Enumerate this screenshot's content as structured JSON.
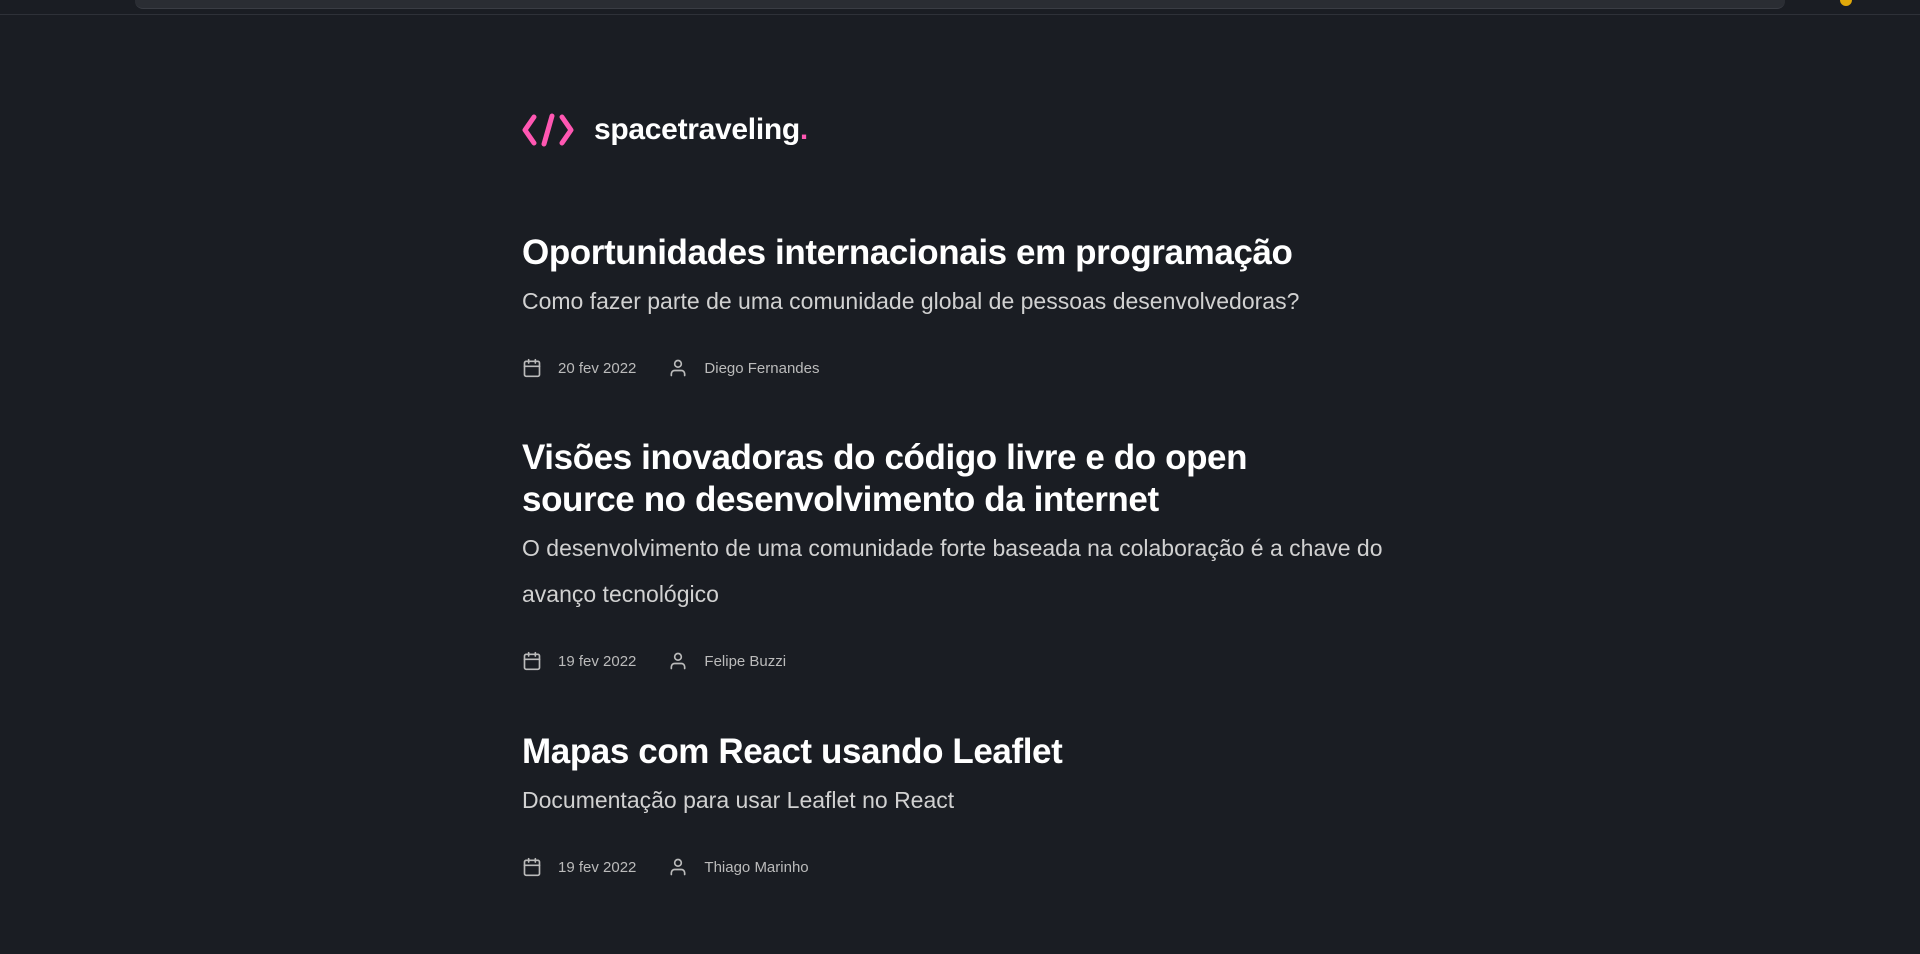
{
  "header": {
    "logo_icon": "code-brackets-icon",
    "logo_text": "spacetraveling",
    "logo_dot": ".",
    "accent_color": "#ff57b2"
  },
  "posts": [
    {
      "title": "Oportunidades internacionais em programação",
      "subtitle": "Como fazer parte de uma comunidade global de pessoas desenvolvedoras?",
      "date": "20 fev 2022",
      "author": "Diego Fernandes"
    },
    {
      "title": "Visões inovadoras do código livre e do open source no desenvolvimento da internet",
      "subtitle": "O desenvolvimento de uma comunidade forte baseada na colaboração é a chave do avanço tecnológico",
      "date": "19 fev 2022",
      "author": "Felipe Buzzi"
    },
    {
      "title": "Mapas com React usando Leaflet",
      "subtitle": "Documentação para usar Leaflet no React",
      "date": "19 fev 2022",
      "author": "Thiago Marinho"
    }
  ],
  "icons": {
    "date": "calendar-icon",
    "author": "user-icon"
  }
}
